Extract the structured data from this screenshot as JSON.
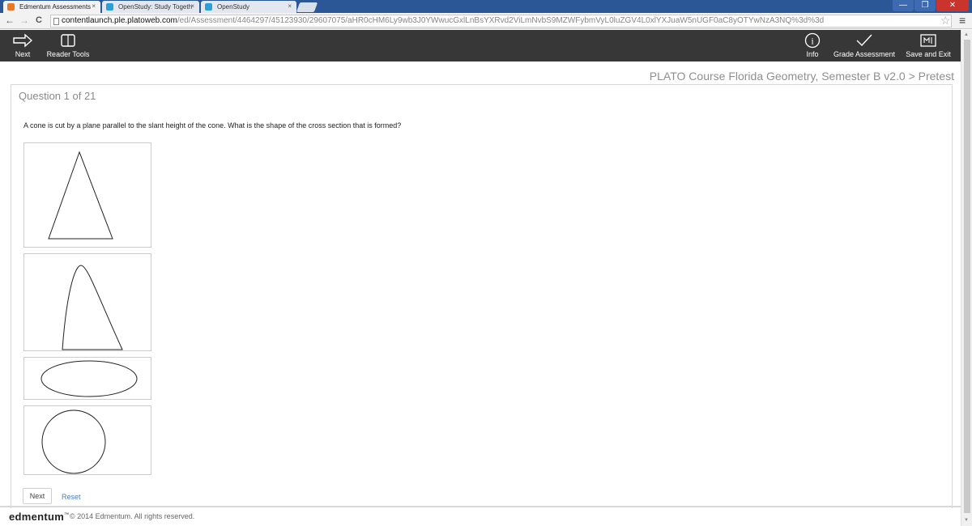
{
  "browser": {
    "tabs": [
      {
        "label": "Edmentum Assessments",
        "close": "×",
        "favicon_color": "#e8792b"
      },
      {
        "label": "OpenStudy: Study Togeth",
        "close": "×",
        "favicon_color": "#2a9fd8"
      },
      {
        "label": "OpenStudy",
        "close": "×",
        "favicon_color": "#2a9fd8"
      }
    ],
    "window_controls": {
      "minimize": "—",
      "maximize": "❐",
      "close": "✕"
    },
    "nav": {
      "back": "←",
      "forward": "→",
      "reload": "C"
    },
    "url_host": "contentlaunch.ple.platoweb.com",
    "url_path": "/ed/Assessment/4464297/45123930/29607075/aHR0cHM6Ly9wb3J0YWwucGxlLnBsYXRvd2ViLmNvbS9MZWFybmVyL0luZGV4L0xlYXJuaW5nUGF0aC8yOTYwNzA3NQ%3d%3d",
    "star": "☆",
    "menu": "≡"
  },
  "toolbar": {
    "next": {
      "label": "Next",
      "icon": "arrow-right-icon"
    },
    "reader_tools": {
      "label": "Reader Tools",
      "icon": "book-icon"
    },
    "info": {
      "label": "Info",
      "icon": "info-icon",
      "glyph": "i"
    },
    "grade": {
      "label": "Grade Assessment",
      "icon": "checkmark-icon"
    },
    "save_exit": {
      "label": "Save and Exit",
      "icon": "save-exit-icon"
    }
  },
  "course_title": "PLATO Course Florida Geometry, Semester B v2.0 > Pretest",
  "question": {
    "number_label": "Question 1 of 21",
    "text": "A cone is cut by a plane parallel to the slant height of the cone. What is the shape of the cross section that is formed?",
    "choices": [
      {
        "shape": "triangle",
        "selected": false
      },
      {
        "shape": "parabola",
        "selected": false
      },
      {
        "shape": "ellipse",
        "selected": false
      },
      {
        "shape": "circle",
        "selected": false
      }
    ]
  },
  "actions": {
    "next": "Next",
    "reset": "Reset"
  },
  "footer": {
    "brand": "edmentum",
    "tm": "™",
    "copyright": "© 2014 Edmentum. All rights reserved."
  },
  "colors": {
    "toolbar_bg": "#373737",
    "tabstrip_bg": "#2b5797",
    "link": "#4a7fc1",
    "close_btn": "#c9352c"
  }
}
